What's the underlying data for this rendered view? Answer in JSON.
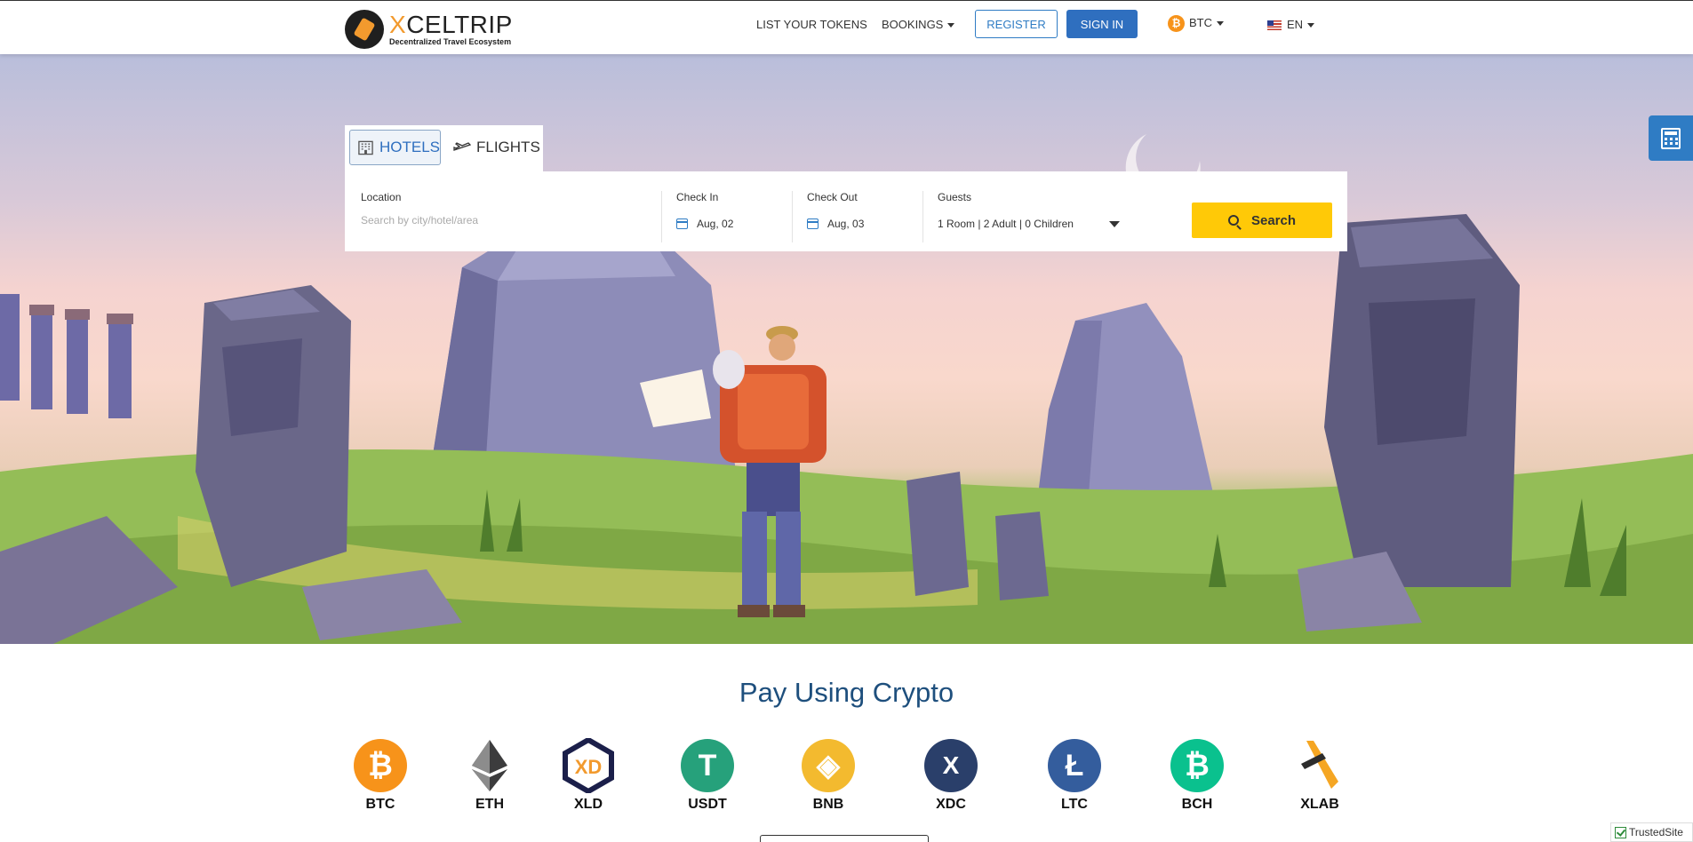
{
  "header": {
    "logo_name_prefix": "X",
    "logo_name_rest": "CELTRIP",
    "logo_tagline": "Decentralized Travel Ecosystem",
    "nav_list_tokens": "LIST YOUR TOKENS",
    "nav_bookings": "BOOKINGS",
    "register_label": "REGISTER",
    "signin_label": "SIGN IN",
    "currency_label": "BTC",
    "currency_symbol": "₿",
    "language_label": "EN"
  },
  "search": {
    "tab_hotels": "HOTELS",
    "tab_flights": "FLIGHTS",
    "location_label": "Location",
    "location_placeholder": "Search by city/hotel/area",
    "checkin_label": "Check In",
    "checkin_value": "Aug, 02",
    "checkout_label": "Check Out",
    "checkout_value": "Aug, 03",
    "guests_label": "Guests",
    "guests_value": "1 Room | 2 Adult | 0 Children",
    "search_button": "Search"
  },
  "crypto": {
    "title": "Pay Using Crypto",
    "coins": [
      {
        "label": "BTC",
        "symbol": "₿",
        "color": "#f7931a"
      },
      {
        "label": "ETH",
        "symbol": "◆",
        "color": "#3c3c3d"
      },
      {
        "label": "XLD",
        "symbol": "XD",
        "color": "#1b1f4a"
      },
      {
        "label": "USDT",
        "symbol": "T",
        "color": "#26a17b"
      },
      {
        "label": "BNB",
        "symbol": "◈",
        "color": "#f3ba2f"
      },
      {
        "label": "XDC",
        "symbol": "X",
        "color": "#2a3f6a"
      },
      {
        "label": "LTC",
        "symbol": "Ł",
        "color": "#345d9d"
      },
      {
        "label": "BCH",
        "symbol": "₿",
        "color": "#0ac18e"
      },
      {
        "label": "XLAB",
        "symbol": "✕",
        "color": "#f5a623"
      }
    ]
  },
  "footer": {
    "trusted_label": "TrustedSite"
  },
  "colors": {
    "accent": "#2f7cc4",
    "search_button": "#ffc907",
    "title": "#1e4f7d"
  }
}
